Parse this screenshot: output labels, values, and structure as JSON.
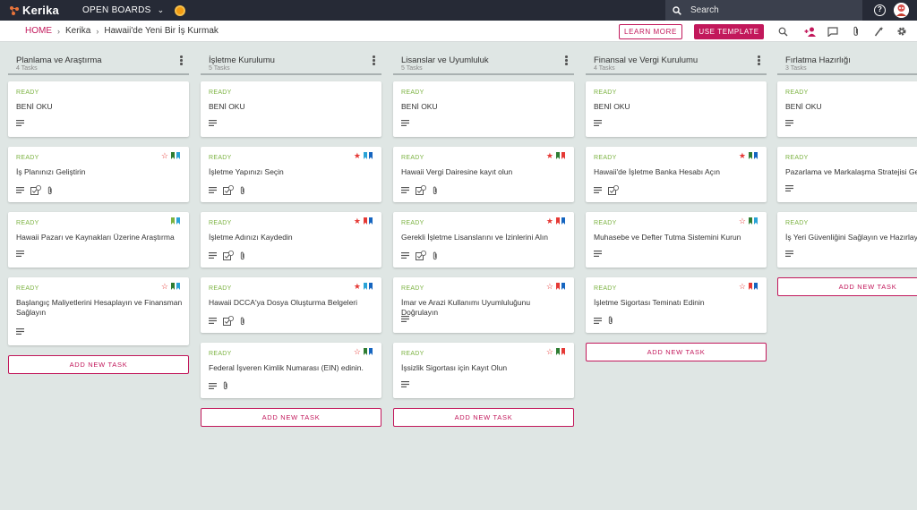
{
  "topbar": {
    "logo": "Kerika",
    "open_boards": "OPEN BOARDS",
    "search_placeholder": "Search"
  },
  "breadcrumb": {
    "home": "HOME",
    "org": "Kerika",
    "board": "Hawaii'de Yeni Bir İş Kurmak"
  },
  "toolbar": {
    "learn_more": "LEARN MORE",
    "use_template": "USE TEMPLATE",
    "icons": [
      "search-icon",
      "add-person-icon",
      "chat-icon",
      "attachment-icon",
      "wand-icon",
      "gear-icon"
    ]
  },
  "colors": {
    "accent": "#c2185b",
    "ready": "#7cb342",
    "star_red": "#e53935",
    "flag_green": "#2e7d32",
    "flag_blue": "#1565c0",
    "flag_lightblue": "#29a3d6",
    "flag_lime": "#7cb342",
    "flag_red": "#e53935"
  },
  "columns": [
    {
      "title": "Planlama ve Araştırma",
      "count": "4 Tasks",
      "add_label": "ADD NEW TASK",
      "cards": [
        {
          "status": "READY",
          "title": "BENİ OKU",
          "icons": [
            "desc"
          ],
          "star": "none",
          "flags": []
        },
        {
          "status": "READY",
          "title": "İş Planınızı Geliştirin",
          "icons": [
            "desc",
            "checklist",
            "attach"
          ],
          "star": "outline",
          "flags": [
            "green",
            "lightblue"
          ]
        },
        {
          "status": "READY",
          "title": "Hawaii Pazarı ve Kaynakları Üzerine Araştırma",
          "icons": [
            "desc"
          ],
          "star": "none",
          "flags": [
            "lime",
            "lightblue"
          ]
        },
        {
          "status": "READY",
          "title": "Başlangıç Maliyetlerini Hesaplayın ve Finansman Sağlayın",
          "icons": [
            "desc"
          ],
          "star": "outline",
          "flags": [
            "green",
            "lightblue"
          ]
        }
      ]
    },
    {
      "title": "İşletme Kurulumu",
      "count": "5 Tasks",
      "add_label": "ADD NEW TASK",
      "cards": [
        {
          "status": "READY",
          "title": "BENİ OKU",
          "icons": [
            "desc"
          ],
          "star": "none",
          "flags": []
        },
        {
          "status": "READY",
          "title": "İşletme Yapınızı Seçin",
          "icons": [
            "desc",
            "checklist",
            "attach"
          ],
          "star": "filled",
          "flags": [
            "lightblue",
            "blue"
          ]
        },
        {
          "status": "READY",
          "title": "İşletme Adınızı Kaydedin",
          "icons": [
            "desc",
            "checklist",
            "attach"
          ],
          "star": "filled",
          "flags": [
            "red",
            "blue"
          ]
        },
        {
          "status": "READY",
          "title": "Hawaii DCCA'ya Dosya Oluşturma Belgeleri",
          "icons": [
            "desc",
            "checklist",
            "attach"
          ],
          "star": "filled",
          "flags": [
            "lightblue",
            "blue"
          ]
        },
        {
          "status": "READY",
          "title": "Federal İşveren Kimlik Numarası (EIN) edinin.",
          "icons": [
            "desc",
            "attach"
          ],
          "star": "outline",
          "flags": [
            "green",
            "blue"
          ]
        }
      ]
    },
    {
      "title": "Lisanslar ve Uyumluluk",
      "count": "5 Tasks",
      "add_label": "ADD NEW TASK",
      "cards": [
        {
          "status": "READY",
          "title": "BENİ OKU",
          "icons": [
            "desc"
          ],
          "star": "none",
          "flags": []
        },
        {
          "status": "READY",
          "title": "Hawaii Vergi Dairesine kayıt olun",
          "icons": [
            "desc",
            "checklist",
            "attach"
          ],
          "star": "filled",
          "flags": [
            "green",
            "red"
          ]
        },
        {
          "status": "READY",
          "title": "Gerekli İşletme Lisanslarını ve İzinlerini Alın",
          "icons": [
            "desc",
            "checklist",
            "attach"
          ],
          "star": "filled",
          "flags": [
            "red",
            "blue"
          ]
        },
        {
          "status": "READY",
          "title": "İmar ve Arazi Kullanımı Uyumluluğunu Doğrulayın",
          "icons": [
            "desc"
          ],
          "star": "outline",
          "flags": [
            "red",
            "blue"
          ]
        },
        {
          "status": "READY",
          "title": "İşsizlik Sigortası için Kayıt Olun",
          "icons": [
            "desc"
          ],
          "star": "outline",
          "flags": [
            "green",
            "red"
          ]
        }
      ]
    },
    {
      "title": "Finansal ve Vergi Kurulumu",
      "count": "4 Tasks",
      "add_label": "ADD NEW TASK",
      "cards": [
        {
          "status": "READY",
          "title": "BENİ OKU",
          "icons": [
            "desc"
          ],
          "star": "none",
          "flags": []
        },
        {
          "status": "READY",
          "title": "Hawaii'de İşletme Banka Hesabı Açın",
          "icons": [
            "desc",
            "checklist"
          ],
          "star": "filled",
          "flags": [
            "green",
            "blue"
          ]
        },
        {
          "status": "READY",
          "title": "Muhasebe ve Defter Tutma Sistemini Kurun",
          "icons": [
            "desc"
          ],
          "star": "outline",
          "flags": [
            "green",
            "lightblue"
          ]
        },
        {
          "status": "READY",
          "title": "İşletme Sigortası Teminatı Edinin",
          "icons": [
            "desc",
            "attach"
          ],
          "star": "outline",
          "flags": [
            "red",
            "blue"
          ]
        }
      ]
    },
    {
      "title": "Fırlatma Hazırlığı",
      "count": "3 Tasks",
      "add_label": "ADD NEW TASK",
      "cards": [
        {
          "status": "READY",
          "title": "BENİ OKU",
          "icons": [
            "desc"
          ],
          "star": "none",
          "flags": []
        },
        {
          "status": "READY",
          "title": "Pazarlama ve Markalaşma Stratejisi Geliştirin",
          "icons": [
            "desc"
          ],
          "star": "none",
          "flags": []
        },
        {
          "status": "READY",
          "title": "İş Yeri Güvenliğini Sağlayın ve Hazırlayın",
          "icons": [
            "desc"
          ],
          "star": "none",
          "flags": []
        }
      ]
    }
  ]
}
